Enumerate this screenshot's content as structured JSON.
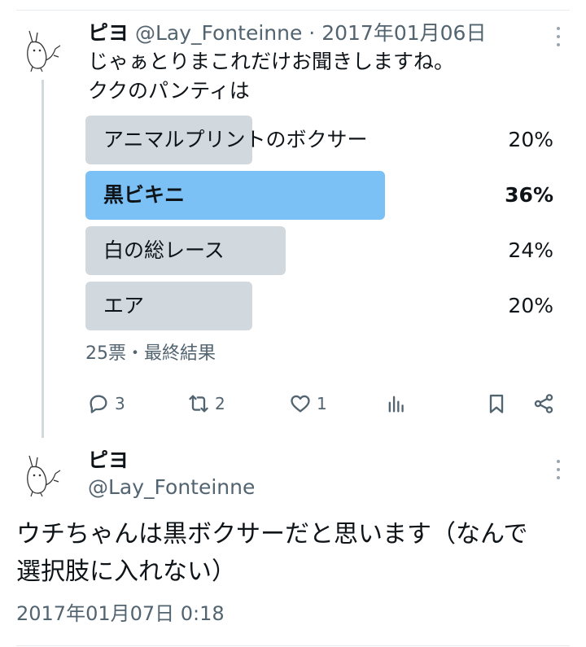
{
  "colors": {
    "bar": "#d1d9de",
    "winner_bar": "#7cc1f5",
    "text": "#0f1419",
    "secondary_text": "#536471"
  },
  "tweet": {
    "display_name": "ピヨ",
    "handle": "@Lay_Fonteinne",
    "separator": "·",
    "date": "2017年01月06日",
    "text_lines": [
      "じゃぁとりまこれだけお聞きしますね。",
      "ククのパンティは"
    ],
    "poll": {
      "options": [
        {
          "label": "アニマルプリントのボクサー",
          "percent_text": "20%",
          "value": 0.2,
          "winner": false
        },
        {
          "label": "黒ビキニ",
          "percent_text": "36%",
          "value": 0.36,
          "winner": true
        },
        {
          "label": "白の総レース",
          "percent_text": "24%",
          "value": 0.24,
          "winner": false
        },
        {
          "label": "エア",
          "percent_text": "20%",
          "value": 0.2,
          "winner": false
        }
      ],
      "summary": "25票・最終結果"
    },
    "actions": {
      "reply": {
        "icon": "reply-icon",
        "count": "3"
      },
      "retweet": {
        "icon": "retweet-icon",
        "count": "2"
      },
      "like": {
        "icon": "heart-icon",
        "count": "1"
      },
      "analytics": {
        "icon": "analytics-icon"
      },
      "bookmark": {
        "icon": "bookmark-icon"
      },
      "share": {
        "icon": "share-icon"
      }
    }
  },
  "reply": {
    "display_name": "ピヨ",
    "handle": "@Lay_Fonteinne",
    "text_lines": [
      "ウチちゃんは黒ボクサーだと思います（なんで",
      "選択肢に入れない）"
    ],
    "timestamp": "2017年01月07日 0:18"
  }
}
